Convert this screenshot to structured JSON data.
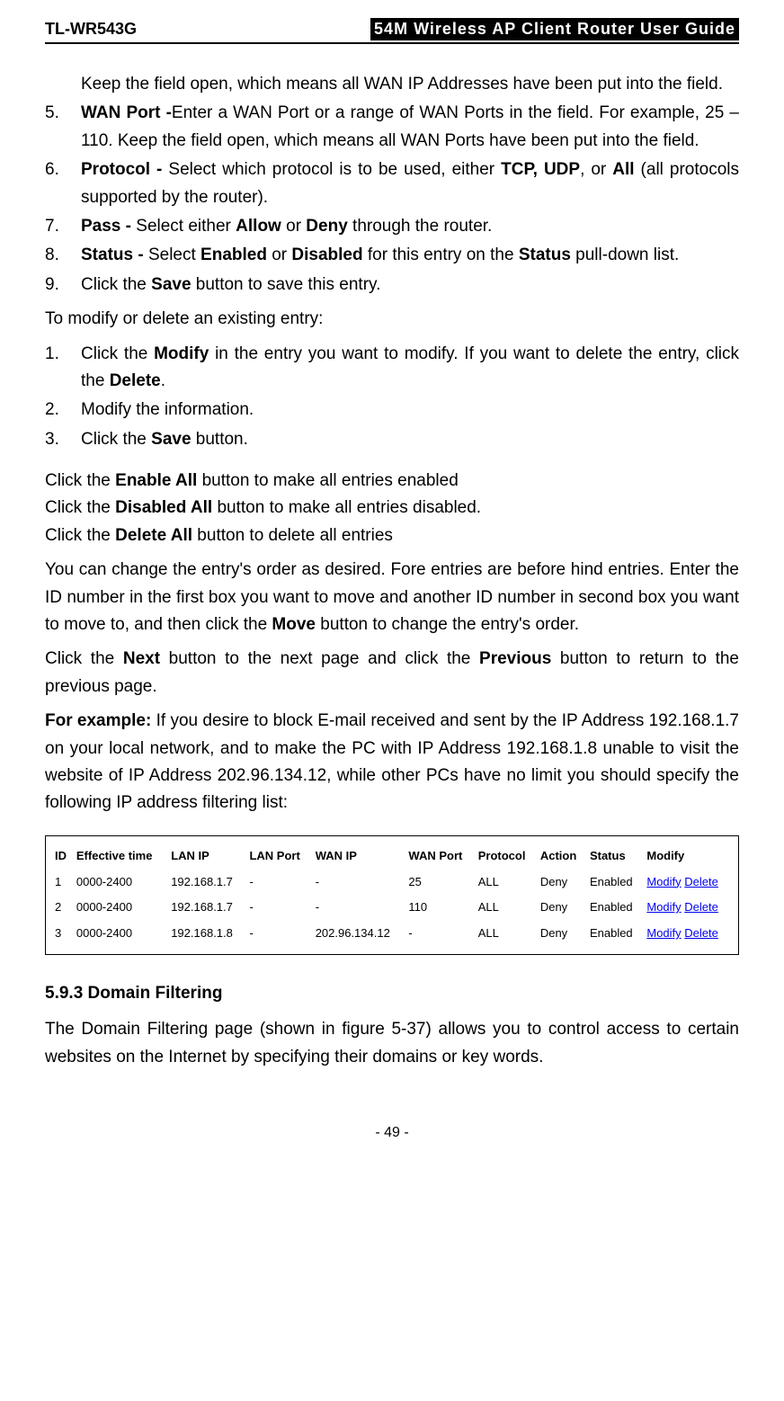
{
  "header": {
    "model": "TL-WR543G",
    "title": "54M Wireless AP Client Router User Guide"
  },
  "intro_line": "Keep the field open, which means all WAN IP Addresses have been put into the field.",
  "steps1": [
    {
      "num": "5.",
      "b": "WAN Port -",
      "t": "Enter a WAN Port or a range of WAN Ports in the field. For example, 25 – 110. Keep the field open, which means all WAN Ports have been put into the field."
    },
    {
      "num": "6.",
      "b": "Protocol - ",
      "t_pre": "Select which protocol is to be used, either ",
      "b1": "TCP, UDP",
      "t_mid": ", or ",
      "b2": "All",
      "t_post": " (all protocols supported by the router)."
    },
    {
      "num": "7.",
      "b": "Pass - ",
      "t_pre": "Select either ",
      "b1": "Allow",
      "t_mid": " or ",
      "b2": "Deny",
      "t_post": " through the router."
    },
    {
      "num": "8.",
      "b": "Status - ",
      "t_pre": "Select ",
      "b1": "Enabled",
      "t_mid": " or ",
      "b2": "Disabled",
      "t_mid2": " for this entry on the ",
      "b3": "Status",
      "t_post": " pull-down list."
    },
    {
      "num": "9.",
      "t_pre": "Click the ",
      "b1": "Save",
      "t_post": " button to save this entry."
    }
  ],
  "modify_intro": "To modify or delete an existing entry:",
  "steps2": [
    {
      "num": "1.",
      "t_pre": "Click the ",
      "b1": "Modify",
      "t_mid": " in the entry you want to modify. If you want to delete the entry, click the ",
      "b2": "Delete",
      "t_post": "."
    },
    {
      "num": "2.",
      "t": "Modify the information."
    },
    {
      "num": "3.",
      "t_pre": "Click the ",
      "b1": "Save",
      "t_post": " button."
    }
  ],
  "bulk": {
    "enable_pre": "Click the ",
    "enable_b": "Enable All",
    "enable_post": " button to make all entries enabled",
    "disable_pre": "Click the ",
    "disable_b": "Disabled All",
    "disable_post": " button to make all entries disabled.",
    "delete_pre": "Click the ",
    "delete_b": "Delete All",
    "delete_post": " button to delete all entries"
  },
  "order_para_pre": "You can change the entry's order as desired. Fore entries are before hind entries. Enter the ID number in the first box you want to move and another ID number in second box you want to move to, and then click the ",
  "order_b": "Move",
  "order_para_post": " button to change the entry's order.",
  "nav_pre": "Click the ",
  "nav_b1": "Next",
  "nav_mid": " button to the next page and click the ",
  "nav_b2": "Previous",
  "nav_post": " button to return to the previous page.",
  "example_b": "For example:",
  "example_text": " If you desire to block E-mail received and sent by the IP Address 192.168.1.7 on your local network, and to make the PC with IP Address 192.168.1.8 unable to visit the website of IP Address 202.96.134.12, while other PCs have no limit you should specify the following IP address filtering list:",
  "table": {
    "headers": [
      "ID",
      "Effective time",
      "LAN IP",
      "LAN Port",
      "WAN IP",
      "WAN Port",
      "Protocol",
      "Action",
      "Status",
      "Modify"
    ],
    "rows": [
      {
        "id": "1",
        "time": "0000-2400",
        "lanip": "192.168.1.7",
        "lanport": "-",
        "wanip": "-",
        "wanport": "25",
        "proto": "ALL",
        "action": "Deny",
        "status": "Enabled",
        "modify": "Modify",
        "del": "Delete"
      },
      {
        "id": "2",
        "time": "0000-2400",
        "lanip": "192.168.1.7",
        "lanport": "-",
        "wanip": "-",
        "wanport": "110",
        "proto": "ALL",
        "action": "Deny",
        "status": "Enabled",
        "modify": "Modify",
        "del": "Delete"
      },
      {
        "id": "3",
        "time": "0000-2400",
        "lanip": "192.168.1.8",
        "lanport": "-",
        "wanip": "202.96.134.12",
        "wanport": "-",
        "proto": "ALL",
        "action": "Deny",
        "status": "Enabled",
        "modify": "Modify",
        "del": "Delete"
      }
    ]
  },
  "section_heading": "5.9.3 Domain Filtering",
  "section_text": "The Domain Filtering page (shown in figure 5-37) allows you to control access to certain websites on the Internet by specifying their domains or key words.",
  "page_number": "- 49 -"
}
